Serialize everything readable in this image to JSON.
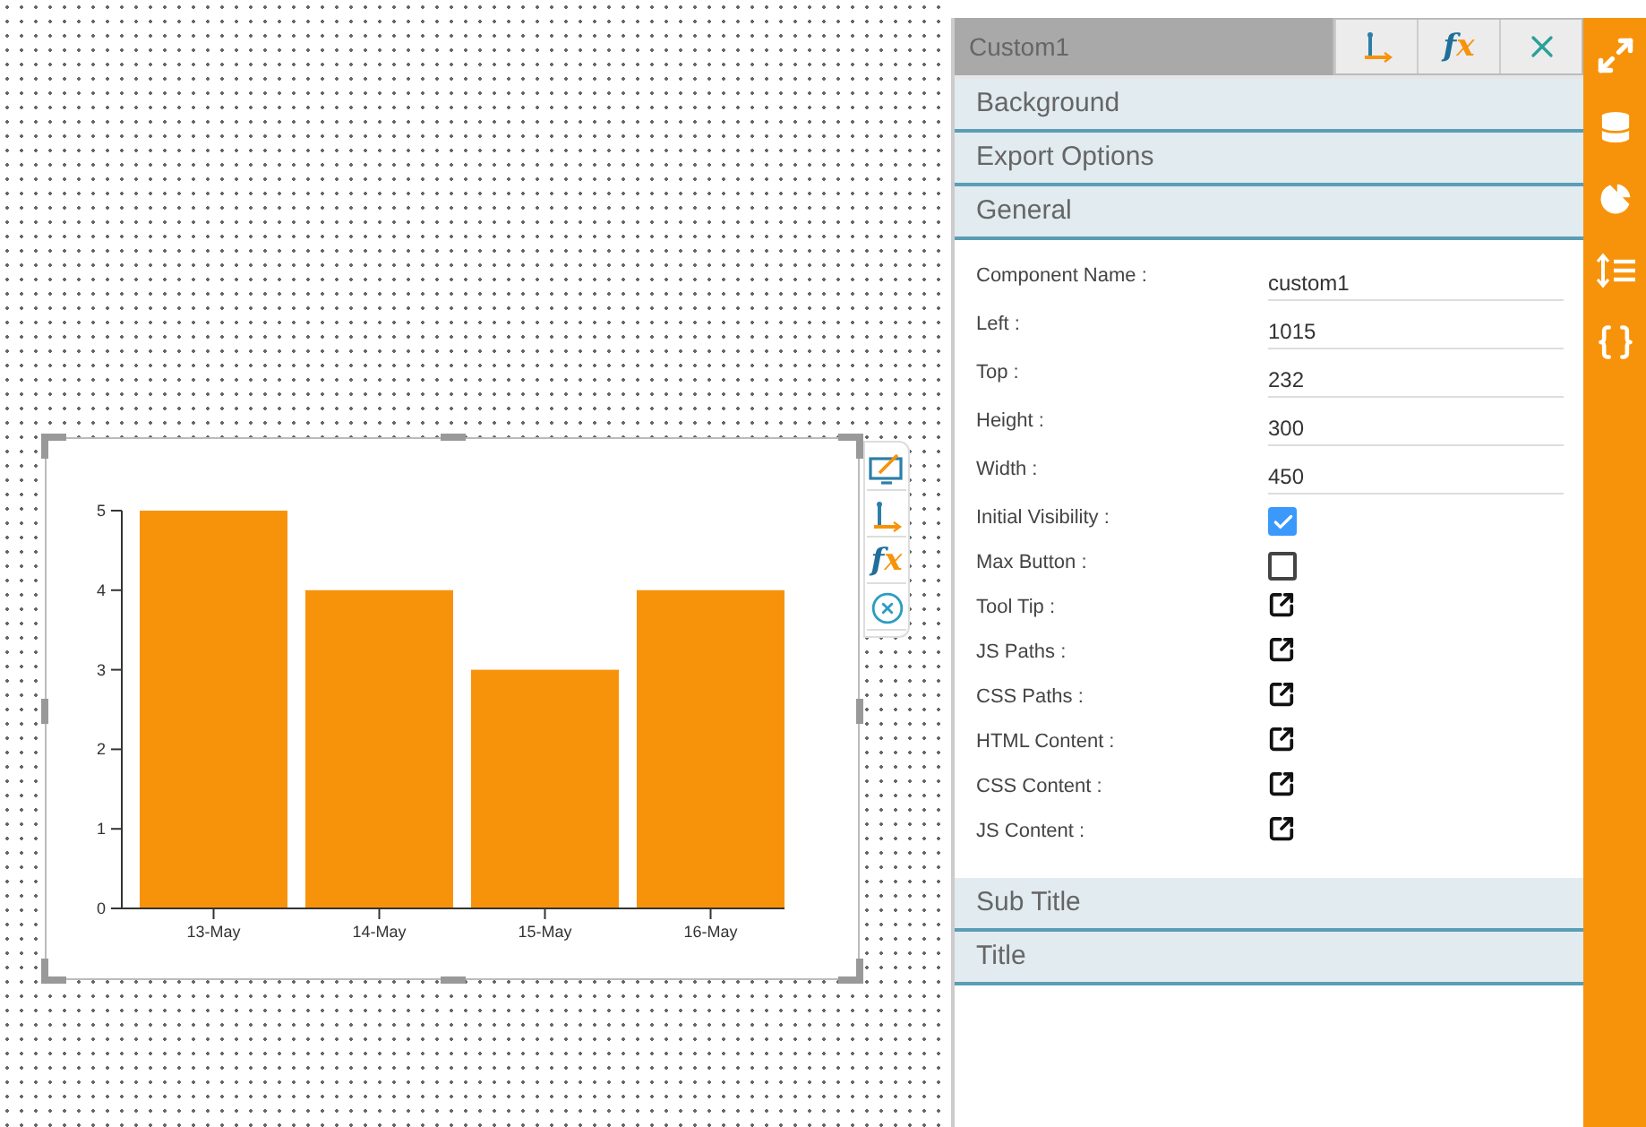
{
  "chart_widget": {
    "toolbar": [
      {
        "kind": "edit"
      },
      {
        "kind": "axes"
      },
      {
        "kind": "function",
        "label": "fx"
      },
      {
        "kind": "remove"
      }
    ],
    "chart_data": {
      "type": "bar",
      "categories": [
        "13-May",
        "14-May",
        "15-May",
        "16-May"
      ],
      "values": [
        5,
        4,
        3,
        4
      ],
      "ylim": [
        0,
        5
      ],
      "yticks": [
        0,
        1,
        2,
        3,
        4,
        5
      ]
    }
  },
  "panel": {
    "title": "Custom1",
    "header_buttons": [
      {
        "kind": "axes"
      },
      {
        "kind": "function",
        "label": "fx"
      },
      {
        "kind": "close"
      }
    ],
    "sections_before": [
      {
        "label": "Background"
      },
      {
        "label": "Export Options"
      },
      {
        "label": "General"
      }
    ],
    "properties": [
      {
        "kind": "text",
        "label": "Component Name :",
        "value": "custom1"
      },
      {
        "kind": "text",
        "label": "Left :",
        "value": "1015"
      },
      {
        "kind": "text",
        "label": "Top :",
        "value": "232"
      },
      {
        "kind": "text",
        "label": "Height :",
        "value": "300"
      },
      {
        "kind": "text",
        "label": "Width :",
        "value": "450"
      },
      {
        "kind": "checkbox",
        "label": "Initial Visibility :",
        "checked": true
      },
      {
        "kind": "checkbox",
        "label": "Max Button :",
        "checked": false
      },
      {
        "kind": "link",
        "label": "Tool Tip :"
      },
      {
        "kind": "link",
        "label": "JS Paths :"
      },
      {
        "kind": "link",
        "label": "CSS Paths :"
      },
      {
        "kind": "link",
        "label": "HTML Content :"
      },
      {
        "kind": "link",
        "label": "CSS Content :"
      },
      {
        "kind": "link",
        "label": "JS Content :"
      }
    ],
    "sections_after": [
      {
        "label": "Sub Title"
      },
      {
        "label": "Title"
      }
    ]
  },
  "side_strip": [
    {
      "kind": "expand"
    },
    {
      "kind": "database"
    },
    {
      "kind": "pie"
    },
    {
      "kind": "sort"
    },
    {
      "kind": "script"
    }
  ]
}
